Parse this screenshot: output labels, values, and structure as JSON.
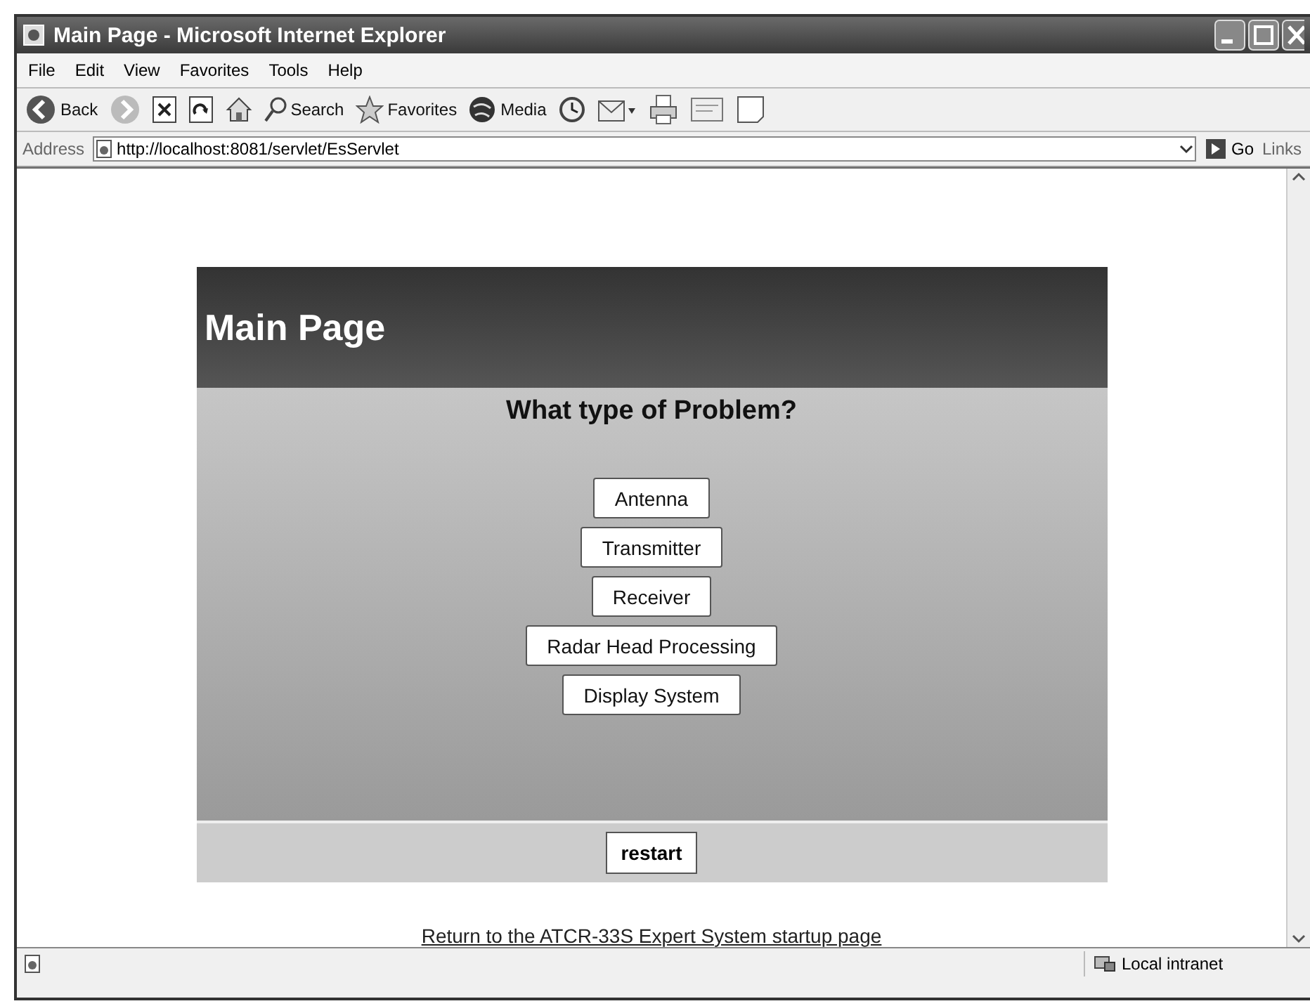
{
  "window": {
    "title": "Main Page - Microsoft Internet Explorer"
  },
  "menu": [
    "File",
    "Edit",
    "View",
    "Favorites",
    "Tools",
    "Help"
  ],
  "toolbar": [
    {
      "kind": "back",
      "label": "Back"
    },
    {
      "kind": "forward"
    },
    {
      "kind": "stop"
    },
    {
      "kind": "refresh"
    },
    {
      "kind": "home"
    },
    {
      "kind": "search",
      "label": "Search"
    },
    {
      "kind": "favorites",
      "label": "Favorites"
    },
    {
      "kind": "media",
      "label": "Media"
    },
    {
      "kind": "history"
    },
    {
      "kind": "mail"
    },
    {
      "kind": "print"
    },
    {
      "kind": "edit"
    },
    {
      "kind": "discuss"
    }
  ],
  "address": {
    "label": "Address",
    "value": "http://localhost:8081/servlet/EsServlet",
    "go": "Go",
    "links": "Links"
  },
  "page": {
    "heading": "Main Page",
    "question": "What type of Problem?",
    "options": [
      "Antenna",
      "Transmitter",
      "Receiver",
      "Radar Head Processing",
      "Display System"
    ],
    "restart": "restart",
    "link": "Return to the ATCR-33S Expert System startup page"
  },
  "status_bar": {
    "zone": "Local intranet"
  }
}
